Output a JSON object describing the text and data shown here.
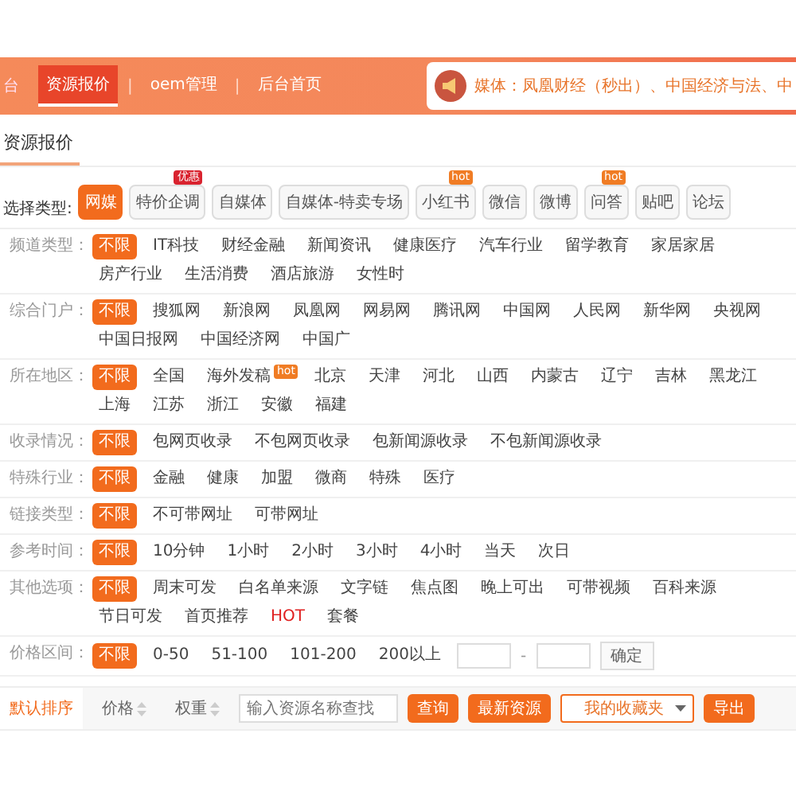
{
  "header": {
    "brand": "台",
    "tabs": [
      {
        "label": "资源报价",
        "selected": true
      },
      {
        "label": "oem管理",
        "selected": false
      },
      {
        "label": "后台首页",
        "selected": false
      }
    ],
    "separator": "|",
    "notice": "媒体：凤凰财经（秒出）、中国经济与法、中"
  },
  "page_title": "资源报价",
  "type_selector": {
    "label": "选择类型:",
    "options": [
      {
        "text": "网媒",
        "selected": true
      },
      {
        "text": "特价企调",
        "selected": false,
        "badge": {
          "text": "优惠",
          "color": "#d9232f"
        }
      },
      {
        "text": "自媒体",
        "selected": false
      },
      {
        "text": "自媒体-特卖专场",
        "selected": false
      },
      {
        "text": "小红书",
        "selected": false,
        "badge": {
          "text": "hot",
          "color": "#f07c24"
        }
      },
      {
        "text": "微信",
        "selected": false
      },
      {
        "text": "微博",
        "selected": false
      },
      {
        "text": "问答",
        "selected": false,
        "badge": {
          "text": "hot",
          "color": "#f07c24"
        }
      },
      {
        "text": "贴吧",
        "selected": false
      },
      {
        "text": "论坛",
        "selected": false
      }
    ]
  },
  "filters": [
    {
      "kind": "options",
      "label": "频道类型：",
      "options": [
        {
          "text": "不限",
          "selected": true
        },
        {
          "text": "IT科技",
          "selected": false
        },
        {
          "text": "财经金融",
          "selected": false
        },
        {
          "text": "新闻资讯",
          "selected": false
        },
        {
          "text": "健康医疗",
          "selected": false
        },
        {
          "text": "汽车行业",
          "selected": false
        },
        {
          "text": "留学教育",
          "selected": false
        },
        {
          "text": "家居家居",
          "selected": false
        },
        {
          "text": "房产行业",
          "selected": false
        },
        {
          "text": "生活消费",
          "selected": false
        },
        {
          "text": "酒店旅游",
          "selected": false
        },
        {
          "text": "女性时",
          "selected": false
        }
      ]
    },
    {
      "kind": "options",
      "label": "综合门户：",
      "options": [
        {
          "text": "不限",
          "selected": true
        },
        {
          "text": "搜狐网",
          "selected": false
        },
        {
          "text": "新浪网",
          "selected": false
        },
        {
          "text": "凤凰网",
          "selected": false
        },
        {
          "text": "网易网",
          "selected": false
        },
        {
          "text": "腾讯网",
          "selected": false
        },
        {
          "text": "中国网",
          "selected": false
        },
        {
          "text": "人民网",
          "selected": false
        },
        {
          "text": "新华网",
          "selected": false
        },
        {
          "text": "央视网",
          "selected": false
        },
        {
          "text": "中国日报网",
          "selected": false
        },
        {
          "text": "中国经济网",
          "selected": false
        },
        {
          "text": "中国广",
          "selected": false
        }
      ]
    },
    {
      "kind": "options",
      "label": "所在地区：",
      "options": [
        {
          "text": "不限",
          "selected": true
        },
        {
          "text": "全国",
          "selected": false
        },
        {
          "text": "海外发稿",
          "selected": false,
          "badge": {
            "text": "hot",
            "color": "#f07c24"
          }
        },
        {
          "text": "北京",
          "selected": false
        },
        {
          "text": "天津",
          "selected": false
        },
        {
          "text": "河北",
          "selected": false
        },
        {
          "text": "山西",
          "selected": false
        },
        {
          "text": "内蒙古",
          "selected": false
        },
        {
          "text": "辽宁",
          "selected": false
        },
        {
          "text": "吉林",
          "selected": false
        },
        {
          "text": "黑龙江",
          "selected": false
        },
        {
          "text": "上海",
          "selected": false
        },
        {
          "text": "江苏",
          "selected": false
        },
        {
          "text": "浙江",
          "selected": false
        },
        {
          "text": "安徽",
          "selected": false
        },
        {
          "text": "福建",
          "selected": false
        }
      ]
    },
    {
      "kind": "options",
      "label": "收录情况：",
      "options": [
        {
          "text": "不限",
          "selected": true
        },
        {
          "text": "包网页收录",
          "selected": false
        },
        {
          "text": "不包网页收录",
          "selected": false
        },
        {
          "text": "包新闻源收录",
          "selected": false
        },
        {
          "text": "不包新闻源收录",
          "selected": false
        }
      ]
    },
    {
      "kind": "options",
      "label": "特殊行业：",
      "options": [
        {
          "text": "不限",
          "selected": true
        },
        {
          "text": "金融",
          "selected": false
        },
        {
          "text": "健康",
          "selected": false
        },
        {
          "text": "加盟",
          "selected": false
        },
        {
          "text": "微商",
          "selected": false
        },
        {
          "text": "特殊",
          "selected": false
        },
        {
          "text": "医疗",
          "selected": false
        }
      ]
    },
    {
      "kind": "options",
      "label": "链接类型：",
      "options": [
        {
          "text": "不限",
          "selected": true
        },
        {
          "text": "不可带网址",
          "selected": false
        },
        {
          "text": "可带网址",
          "selected": false
        }
      ]
    },
    {
      "kind": "options",
      "label": "参考时间：",
      "options": [
        {
          "text": "不限",
          "selected": true
        },
        {
          "text": "10分钟",
          "selected": false
        },
        {
          "text": "1小时",
          "selected": false
        },
        {
          "text": "2小时",
          "selected": false
        },
        {
          "text": "3小时",
          "selected": false
        },
        {
          "text": "4小时",
          "selected": false
        },
        {
          "text": "当天",
          "selected": false
        },
        {
          "text": "次日",
          "selected": false
        }
      ]
    },
    {
      "kind": "options",
      "label": "其他选项：",
      "options": [
        {
          "text": "不限",
          "selected": true
        },
        {
          "text": "周末可发",
          "selected": false
        },
        {
          "text": "白名单来源",
          "selected": false
        },
        {
          "text": "文字链",
          "selected": false
        },
        {
          "text": "焦点图",
          "selected": false
        },
        {
          "text": "晚上可出",
          "selected": false
        },
        {
          "text": "可带视频",
          "selected": false
        },
        {
          "text": "百科来源",
          "selected": false
        },
        {
          "text": "节日可发",
          "selected": false
        },
        {
          "text": "首页推荐",
          "selected": false
        },
        {
          "text": "HOT",
          "selected": false,
          "hot": true
        },
        {
          "text": "套餐",
          "selected": false
        }
      ]
    },
    {
      "kind": "range",
      "label": "价格区间：",
      "options": [
        {
          "text": "不限",
          "selected": true
        },
        {
          "text": "0-50",
          "selected": false
        },
        {
          "text": "51-100",
          "selected": false
        },
        {
          "text": "101-200",
          "selected": false
        },
        {
          "text": "200以上",
          "selected": false
        }
      ],
      "separator": "-",
      "confirm": "确定"
    }
  ],
  "toolbar": {
    "sorts": [
      {
        "text": "默认排序",
        "selected": true,
        "kind": "plain"
      },
      {
        "text": "价格",
        "selected": false,
        "kind": "sortable"
      },
      {
        "text": "权重",
        "selected": false,
        "kind": "sortable"
      }
    ],
    "search": {
      "placeholder": "输入资源名称查找"
    },
    "query_button": "查询",
    "latest_button": "最新资源",
    "favorites": "我的收藏夹",
    "export_button": "导出"
  }
}
